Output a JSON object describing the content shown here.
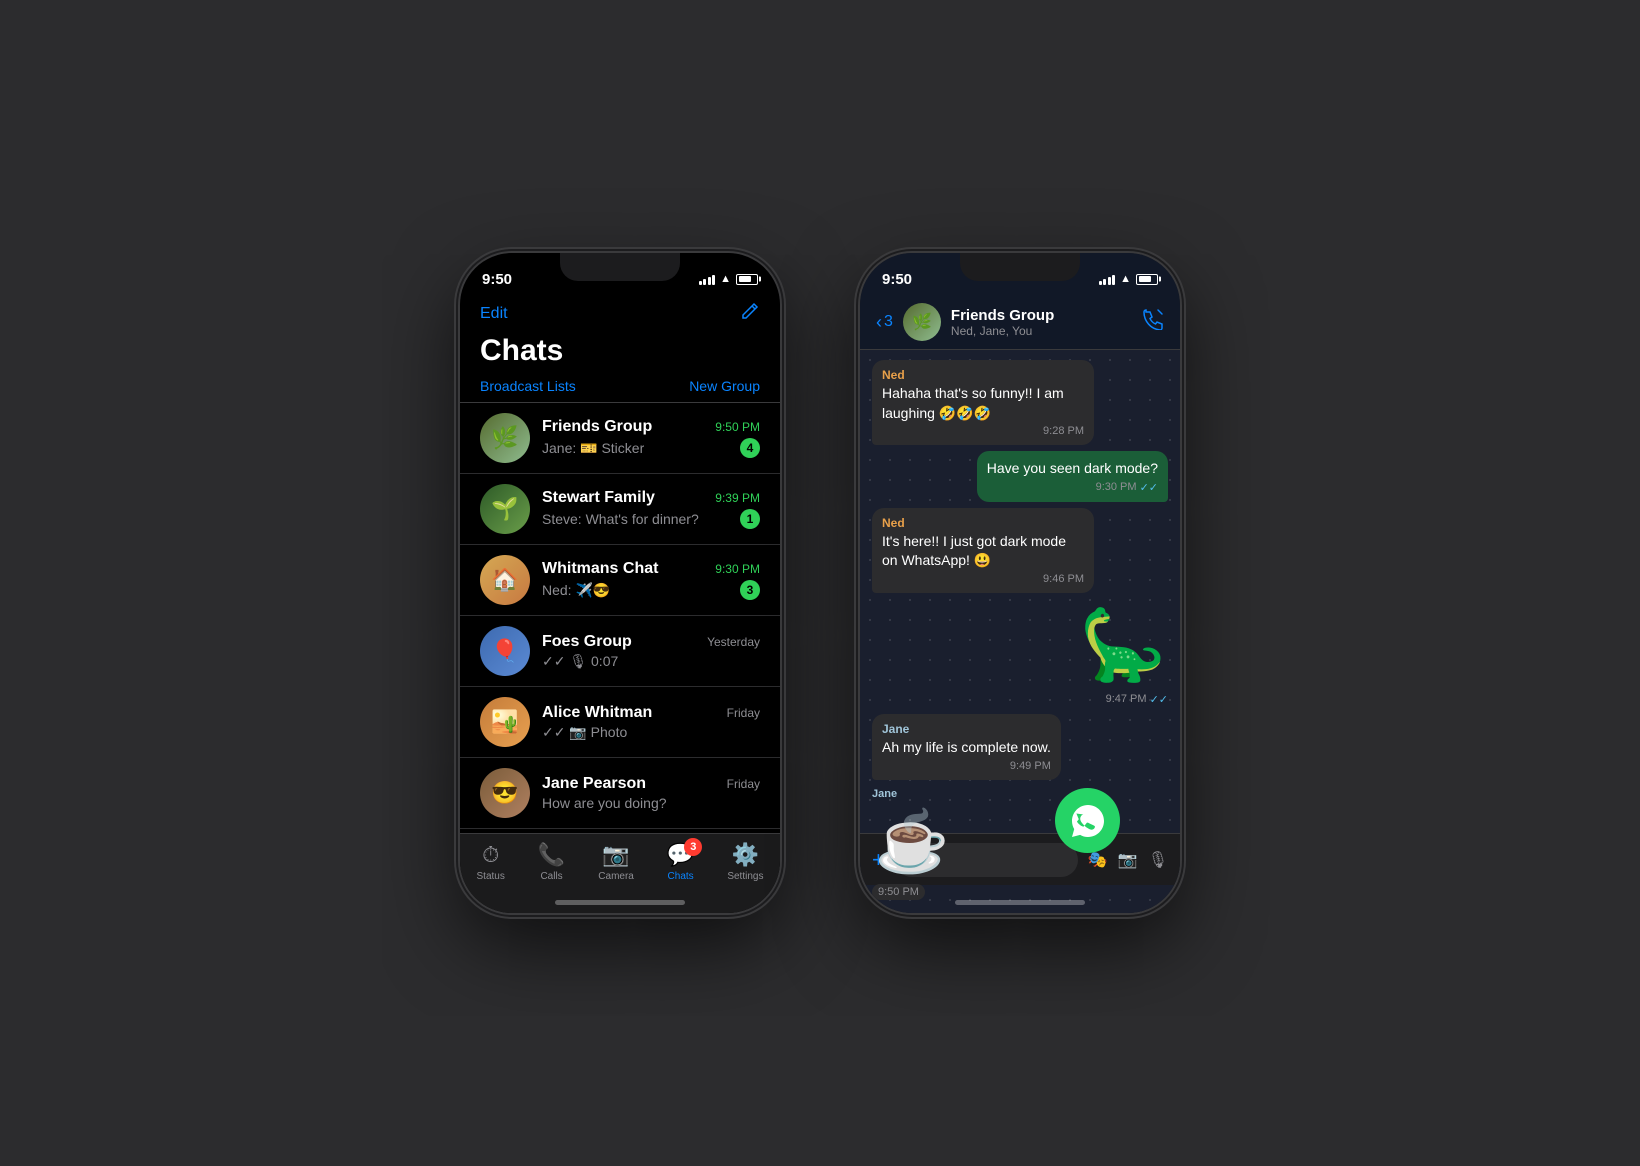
{
  "background": "#2c2c2e",
  "phone1": {
    "status_time": "9:50",
    "nav": {
      "edit": "Edit",
      "compose_icon": "✎"
    },
    "title": "Chats",
    "toolbar": {
      "broadcast": "Broadcast Lists",
      "new_group": "New Group"
    },
    "chats": [
      {
        "id": "friends-group",
        "name": "Friends Group",
        "time": "9:50 PM",
        "preview": "Jane: 🎫 Sticker",
        "badge": "4",
        "avatar_emoji": "🌿"
      },
      {
        "id": "stewart-family",
        "name": "Stewart Family",
        "time": "9:39 PM",
        "preview": "Steve: What's for dinner?",
        "badge": "1",
        "avatar_emoji": "🌱"
      },
      {
        "id": "whitmans-chat",
        "name": "Whitmans Chat",
        "time": "9:30 PM",
        "preview": "Ned: ✈️😎",
        "badge": "3",
        "avatar_emoji": "🏠"
      },
      {
        "id": "foes-group",
        "name": "Foes Group",
        "time": "Yesterday",
        "preview": "✓✓ 🎙 0:07",
        "badge": "",
        "avatar_emoji": "🎈"
      },
      {
        "id": "alice-whitman",
        "name": "Alice Whitman",
        "time": "Friday",
        "preview": "✓✓ 📷 Photo",
        "badge": "",
        "avatar_emoji": "🏜️"
      },
      {
        "id": "jane-pearson",
        "name": "Jane Pearson",
        "time": "Friday",
        "preview": "How are you doing?",
        "badge": "",
        "avatar_emoji": "😎"
      }
    ],
    "tabs": [
      {
        "id": "status",
        "icon": "⏱",
        "label": "Status",
        "active": false
      },
      {
        "id": "calls",
        "icon": "📞",
        "label": "Calls",
        "active": false
      },
      {
        "id": "camera",
        "icon": "📷",
        "label": "Camera",
        "active": false
      },
      {
        "id": "chats",
        "icon": "💬",
        "label": "Chats",
        "active": true,
        "badge": "3"
      },
      {
        "id": "settings",
        "icon": "⚙️",
        "label": "Settings",
        "active": false
      }
    ]
  },
  "phone2": {
    "status_time": "9:50",
    "header": {
      "back_label": "3",
      "name": "Friends Group",
      "subtitle": "Ned, Jane, You",
      "avatar_emoji": "🌿"
    },
    "messages": [
      {
        "id": "msg1",
        "type": "received",
        "sender": "Ned",
        "sender_color": "ned",
        "text": "Hahaha that's so funny!! I am laughing 🤣🤣🤣",
        "time": "9:28 PM",
        "ticks": ""
      },
      {
        "id": "msg2",
        "type": "sent",
        "text": "Have you seen dark mode?",
        "time": "9:30 PM",
        "ticks": "✓✓"
      },
      {
        "id": "msg3",
        "type": "received",
        "sender": "Ned",
        "sender_color": "ned",
        "text": "It's here!! I just got dark mode on WhatsApp! 😃",
        "time": "9:46 PM",
        "ticks": ""
      },
      {
        "id": "msg4",
        "type": "sticker-sent",
        "emoji": "🦕",
        "time": "9:47 PM",
        "ticks": "✓✓"
      },
      {
        "id": "msg5",
        "type": "received",
        "sender": "Jane",
        "sender_color": "jane",
        "text": "Ah my life is complete now.",
        "time": "9:49 PM",
        "ticks": ""
      },
      {
        "id": "msg6",
        "type": "sticker-received",
        "sender": "Jane",
        "sender_color": "jane",
        "emoji": "☕",
        "time": "9:50 PM"
      }
    ],
    "input": {
      "placeholder": ""
    }
  },
  "whatsapp_logo": "💬"
}
